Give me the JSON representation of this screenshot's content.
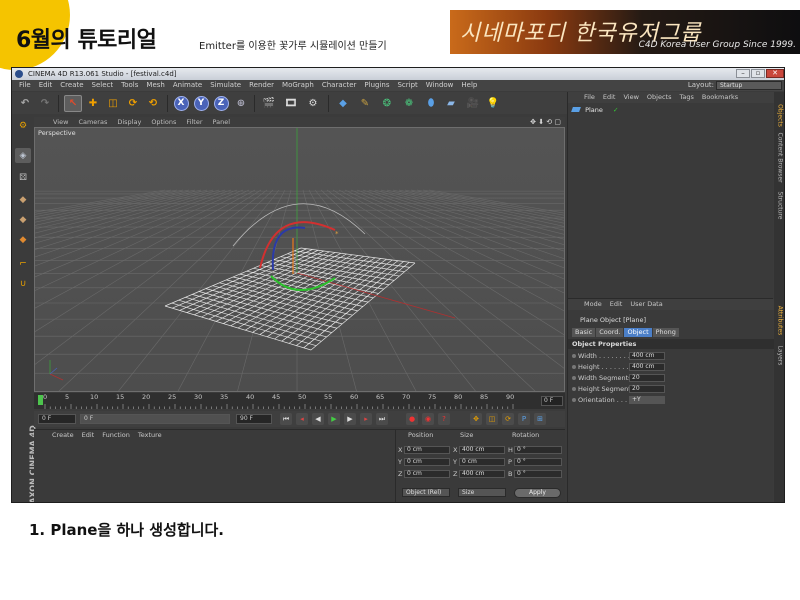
{
  "slide": {
    "title": "6월의 튜토리얼",
    "subtitle": "Emitter를 이용한 꽃가루 시뮬레이션 만들기",
    "banner_calligraphy": "시네마포디 한국유저그룹",
    "banner_tag": "C4D Korea User Group Since 1999.",
    "caption": "1. Plane을 하나 생성합니다.",
    "colors": {
      "accent_yellow": "#f5c400"
    }
  },
  "window": {
    "title": "CINEMA 4D R13.061 Studio - [festival.c4d]",
    "controls": [
      "–",
      "▫",
      "✕"
    ]
  },
  "menubar": {
    "items": [
      "File",
      "Edit",
      "Create",
      "Select",
      "Tools",
      "Mesh",
      "Animate",
      "Simulate",
      "Render",
      "MoGraph",
      "Character",
      "Plugins",
      "Script",
      "Window",
      "Help"
    ],
    "layout_label": "Layout:",
    "layout_value": "Startup"
  },
  "toolbar_icons": [
    "undo-icon",
    "redo-icon",
    "live-selection-icon",
    "move-icon",
    "scale-icon",
    "rotate-icon",
    "recent-tool-icon",
    "x-axis-icon",
    "y-axis-icon",
    "z-axis-icon",
    "coordinate-system-icon",
    "render-view-icon",
    "render-picture-viewer-icon",
    "render-settings-icon",
    "cube-icon",
    "spline-pen-icon",
    "nurbs-icon",
    "array-icon",
    "deformer-icon",
    "floor-icon",
    "camera-icon",
    "light-icon"
  ],
  "axis_labels": {
    "x": "X",
    "y": "Y",
    "z": "Z"
  },
  "viewport": {
    "menu": [
      "View",
      "Cameras",
      "Display",
      "Options",
      "Filter",
      "Panel"
    ],
    "label": "Perspective",
    "nav": "✥ ⬇ ⟲ ▢"
  },
  "timeline": {
    "ticks": [
      "0",
      "5",
      "10",
      "15",
      "20",
      "25",
      "30",
      "35",
      "40",
      "45",
      "50",
      "55",
      "60",
      "65",
      "70",
      "75",
      "80",
      "85",
      "90"
    ],
    "end_field": "0 F"
  },
  "transport": {
    "start": "0 F",
    "min": "0 F",
    "max": "90 F",
    "end": "90 F"
  },
  "material_panel": {
    "menu": [
      "Create",
      "Edit",
      "Function",
      "Texture"
    ]
  },
  "coord_panel": {
    "headers": [
      "Position",
      "Size",
      "Rotation"
    ],
    "rows": [
      {
        "axis": "X",
        "pos": "0 cm",
        "size_axis": "X",
        "size": "400 cm",
        "rot_axis": "H",
        "rot": "0 °"
      },
      {
        "axis": "Y",
        "pos": "0 cm",
        "size_axis": "Y",
        "size": "0 cm",
        "rot_axis": "P",
        "rot": "0 °"
      },
      {
        "axis": "Z",
        "pos": "0 cm",
        "size_axis": "Z",
        "size": "400 cm",
        "rot_axis": "B",
        "rot": "0 °"
      }
    ],
    "mode_select": "Object (Rel)",
    "size_select": "Size",
    "apply": "Apply"
  },
  "objects_panel": {
    "menu": [
      "File",
      "Edit",
      "View",
      "Objects",
      "Tags",
      "Bookmarks"
    ],
    "items": [
      {
        "name": "Plane"
      }
    ]
  },
  "attributes_panel": {
    "menu": [
      "Mode",
      "Edit",
      "User Data"
    ],
    "title": "Plane Object [Plane]",
    "tabs": [
      "Basic",
      "Coord.",
      "Object",
      "Phong"
    ],
    "active_tab": "Object",
    "section": "Object Properties",
    "props": [
      {
        "label": "Width . . . . . . . . .",
        "value": "400 cm"
      },
      {
        "label": "Height . . . . . . . .",
        "value": "400 cm"
      },
      {
        "label": "Width Segments",
        "value": "20"
      },
      {
        "label": "Height Segments",
        "value": "20"
      },
      {
        "label": "Orientation . . . . .",
        "value": "+Y"
      }
    ]
  },
  "side_tabs": [
    "Objects",
    "Content Browser",
    "Structure",
    "Attributes",
    "Layers"
  ],
  "logo_vertical": "MAXON CINEMA 4D"
}
